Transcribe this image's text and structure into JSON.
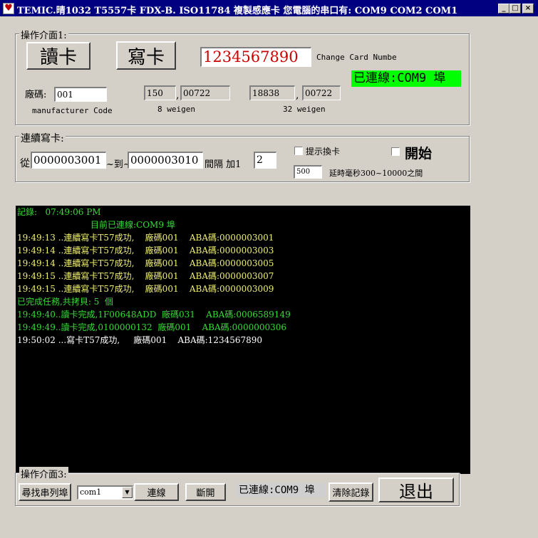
{
  "window": {
    "icon_glyph": "♥",
    "title": "TEMIC.晴1032   T5557卡  FDX-B.  ISO11784   複製感應卡    您電腦的串口有: COM9  COM2  COM1",
    "minimize_glyph": "_",
    "maximize_glyph": "□",
    "close_glyph": "×"
  },
  "panel1": {
    "legend": "操作介面1:",
    "read_button": "讀卡",
    "write_button": "寫卡",
    "card_number": "1234567890",
    "change_card_label": "Change Card Numbe",
    "connection_status": "已連線:COM9 埠",
    "factory_code_label": "廠碼:",
    "factory_code": "001",
    "manufacturer_code_label": "manufacturer Code",
    "w8_left": "150",
    "w8_sep": ",",
    "w8_right": "00722",
    "w8_label": "8 weigen",
    "w32_left": "18838",
    "w32_sep": ",",
    "w32_right": "00722",
    "w32_label": "32 weigen"
  },
  "panel2": {
    "legend": "連續寫卡:",
    "from_label": "從",
    "from_value": "0000003001",
    "to_label": "~到~",
    "to_value": "0000003010",
    "interval_label": "間隔  加1",
    "interval_value": "2",
    "prompt_change_label": "提示換卡",
    "start_label": "開始",
    "delay_value": "500",
    "delay_label": "延時毫秒300~10000之間"
  },
  "log": [
    {
      "text": "記錄:   07:49:06 PM",
      "color": "green"
    },
    {
      "text": "                           目前已連線:COM9 埠",
      "color": "green"
    },
    {
      "text": "19:49:13 ..連續寫卡T57成功,    廠碼001    ABA碼:0000003001",
      "color": "yellow"
    },
    {
      "text": "19:49:14 ..連續寫卡T57成功,    廠碼001    ABA碼:0000003003",
      "color": "yellow"
    },
    {
      "text": "19:49:14 ..連續寫卡T57成功,    廠碼001    ABA碼:0000003005",
      "color": "yellow"
    },
    {
      "text": "19:49:15 ..連續寫卡T57成功,    廠碼001    ABA碼:0000003007",
      "color": "yellow"
    },
    {
      "text": "19:49:15 ..連續寫卡T57成功,    廠碼001    ABA碼:0000003009",
      "color": "yellow"
    },
    {
      "text": "已完成任務,共拷貝: 5  個",
      "color": "green"
    },
    {
      "text": "19:49:40..讀卡完成,1F00648ADD  廠碼031    ABA碼:0006589149",
      "color": "green"
    },
    {
      "text": "19:49:49..讀卡完成,0100000132  廠碼001    ABA碼:0000000306",
      "color": "green"
    },
    {
      "text": "19:50:02 ...寫卡T57成功,     廠碼001    ABA碼:1234567890",
      "color": "white"
    }
  ],
  "panel3": {
    "legend": "操作介面3:",
    "find_ports_button": "尋找串列埠",
    "com_select_value": "com1",
    "dropdown_glyph": "▼",
    "connect_button": "連線",
    "disconnect_button": "斷開",
    "status_text": "已連線:COM9 埠",
    "clear_log_button": "清除記錄",
    "exit_button": "退出"
  },
  "colors": {
    "title_bar": "#000080",
    "card_number_text": "#cc0000",
    "connected_badge_bg": "#00ff00",
    "log_bg": "#000000",
    "log_green": "#33dd33",
    "log_yellow": "#f0f070"
  }
}
